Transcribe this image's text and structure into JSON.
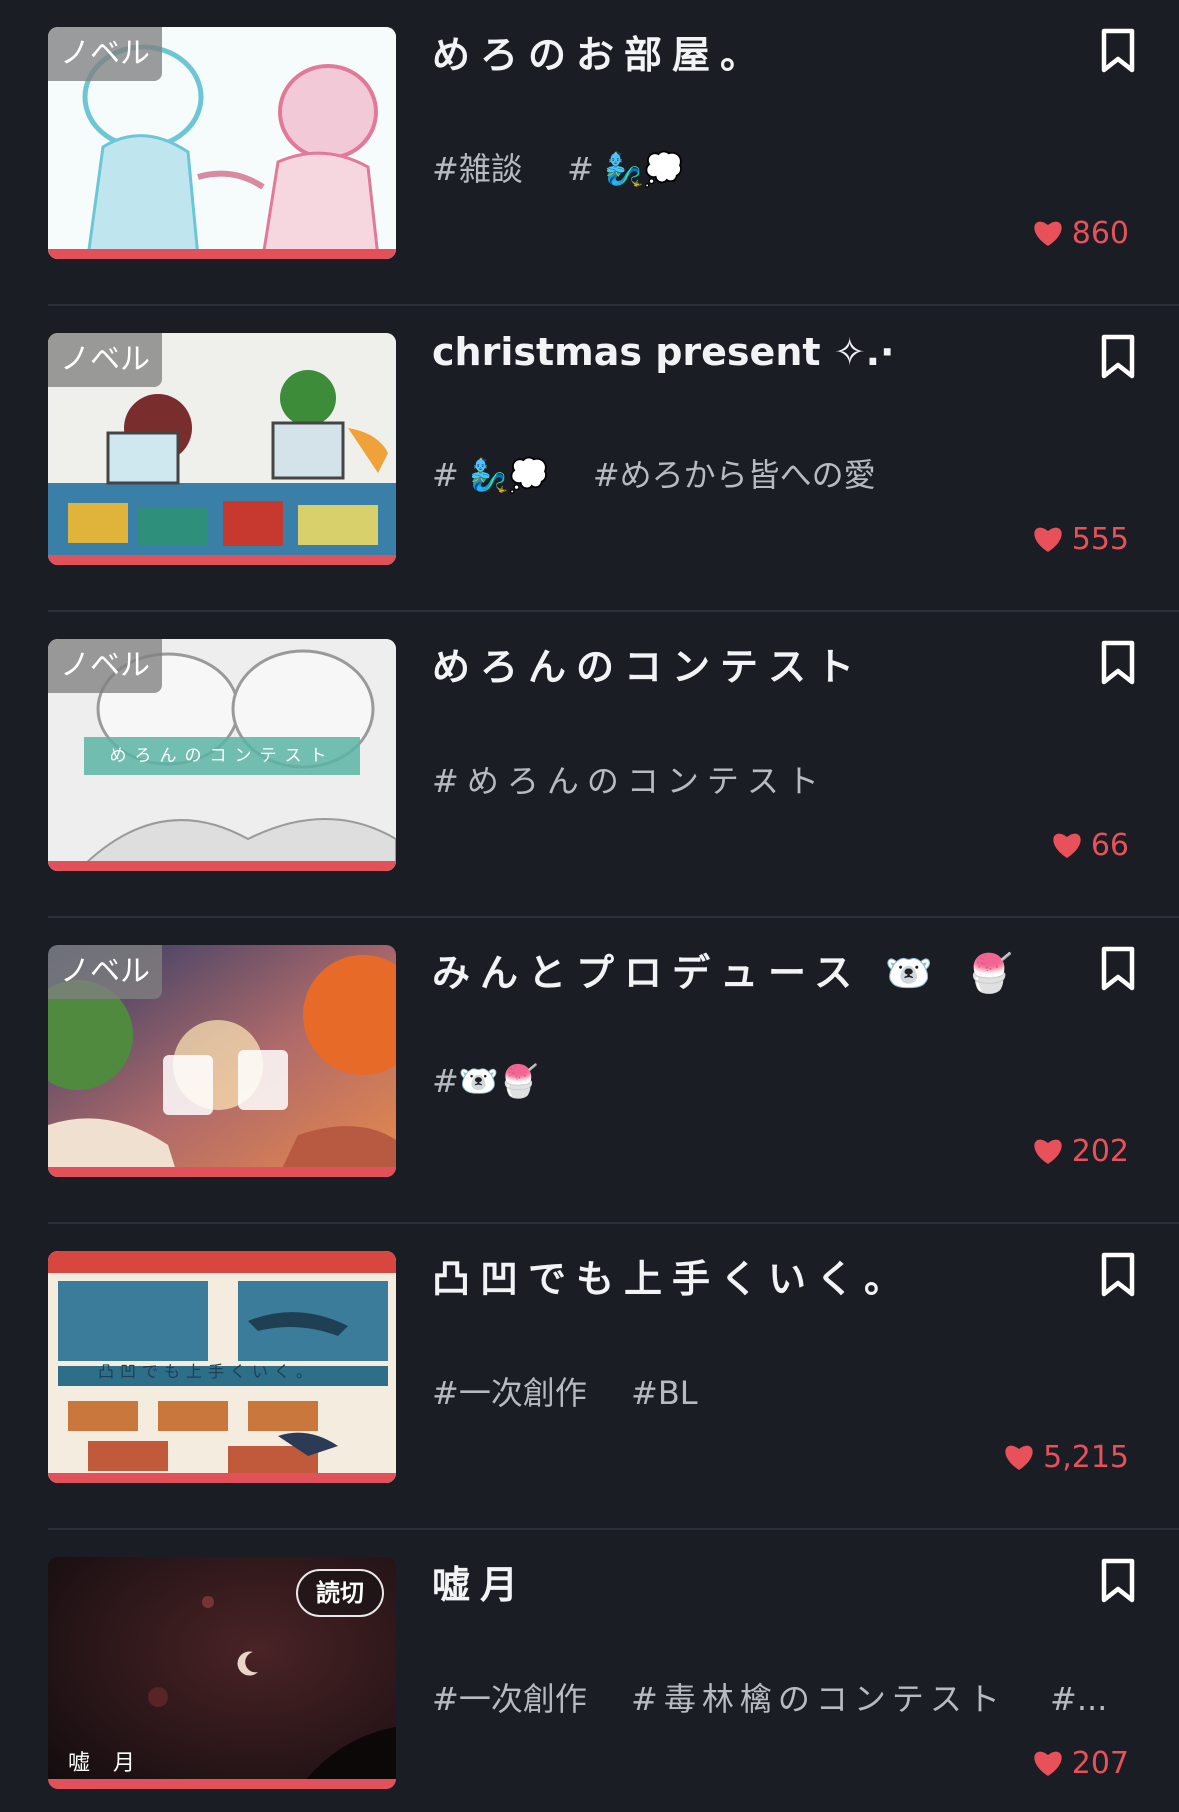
{
  "accent_color": "#e8505a",
  "background_color": "#1a1d24",
  "items": [
    {
      "badge": "ノベル",
      "title": "めろのお部屋。",
      "tags": [
        "#雑談",
        "# 🧞‍♂️💭"
      ],
      "likes": "860",
      "bookmark_icon": "bookmark-icon",
      "like_icon": "heart-icon"
    },
    {
      "badge": "ノベル",
      "title": "christmas present ✧.·",
      "tags": [
        "# 🧞‍♂️💭",
        "#めろから皆への愛"
      ],
      "likes": "555",
      "bookmark_icon": "bookmark-icon",
      "like_icon": "heart-icon"
    },
    {
      "badge": "ノベル",
      "title": "めろんのコンテスト",
      "tags": [
        "#めろんのコンテスト"
      ],
      "likes": "66",
      "thumb_caption": "めろんのコンテスト",
      "bookmark_icon": "bookmark-icon",
      "like_icon": "heart-icon"
    },
    {
      "badge": "ノベル",
      "title": "みんとプロデュース 🐻‍❄️ 🍧",
      "tags": [
        "#🐻‍❄️🍧"
      ],
      "likes": "202",
      "bookmark_icon": "bookmark-icon",
      "like_icon": "heart-icon"
    },
    {
      "badge": "",
      "title": "凸凹でも上手くいく。",
      "tags": [
        "#一次創作",
        "#BL"
      ],
      "likes": "5,215",
      "thumb_caption": "凸凹でも上手くいく。",
      "bookmark_icon": "bookmark-icon",
      "like_icon": "heart-icon"
    },
    {
      "badge": "読切",
      "title": "嘘月",
      "tags": [
        "#一次創作",
        "#毒林檎のコンテスト",
        "#..."
      ],
      "likes": "207",
      "thumb_caption": "嘘 月",
      "bookmark_icon": "bookmark-icon",
      "like_icon": "heart-icon"
    }
  ]
}
